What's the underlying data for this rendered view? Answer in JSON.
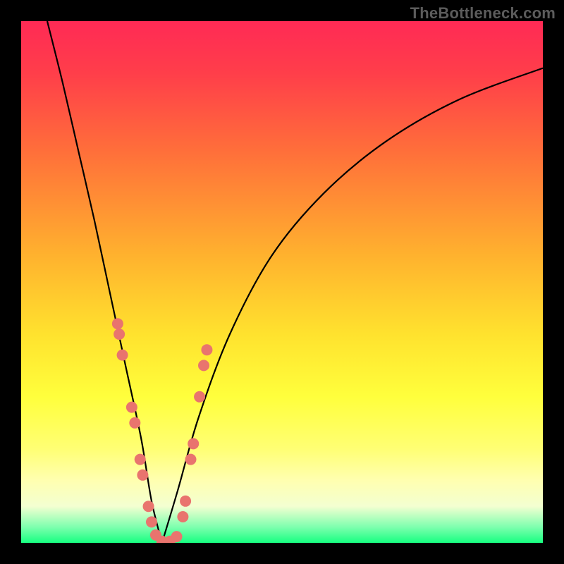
{
  "watermark": "TheBottleneck.com",
  "colors": {
    "frame": "#000000",
    "gradient_stops": [
      {
        "offset": 0.0,
        "color": "#ff2a55"
      },
      {
        "offset": 0.1,
        "color": "#ff3e4a"
      },
      {
        "offset": 0.25,
        "color": "#ff6f3a"
      },
      {
        "offset": 0.45,
        "color": "#ffb22e"
      },
      {
        "offset": 0.6,
        "color": "#ffe22e"
      },
      {
        "offset": 0.72,
        "color": "#ffff3c"
      },
      {
        "offset": 0.82,
        "color": "#ffff74"
      },
      {
        "offset": 0.88,
        "color": "#ffffb0"
      },
      {
        "offset": 0.93,
        "color": "#f3ffd1"
      },
      {
        "offset": 0.97,
        "color": "#7dffae"
      },
      {
        "offset": 1.0,
        "color": "#17ff81"
      }
    ],
    "curve": "#000000",
    "markers": "#e9746e"
  },
  "chart_data": {
    "type": "line",
    "title": "",
    "xlabel": "",
    "ylabel": "",
    "xlim": [
      0,
      100
    ],
    "ylim": [
      0,
      100
    ],
    "note": "x and y are in percent of plot area width/height; y increases upward. Curve is a V-shaped bottleneck profile with minimum around x≈27, y≈0.",
    "series": [
      {
        "name": "bottleneck-curve-left",
        "x": [
          5,
          8,
          11,
          14,
          17,
          20,
          23,
          25,
          27
        ],
        "y": [
          100,
          88,
          75,
          62,
          48,
          34,
          20,
          8,
          0
        ]
      },
      {
        "name": "bottleneck-curve-right",
        "x": [
          27,
          30,
          34,
          40,
          48,
          58,
          70,
          84,
          100
        ],
        "y": [
          0,
          10,
          24,
          40,
          55,
          67,
          77,
          85,
          91
        ]
      }
    ],
    "markers": {
      "name": "highlighted-points",
      "points_xy": [
        [
          18.5,
          42
        ],
        [
          18.8,
          40
        ],
        [
          19.4,
          36
        ],
        [
          21.2,
          26
        ],
        [
          21.8,
          23
        ],
        [
          22.8,
          16
        ],
        [
          23.3,
          13
        ],
        [
          24.4,
          7
        ],
        [
          25.0,
          4
        ],
        [
          25.8,
          1.5
        ],
        [
          27.0,
          0.3
        ],
        [
          28.5,
          0.3
        ],
        [
          29.8,
          1.2
        ],
        [
          31.0,
          5
        ],
        [
          31.5,
          8
        ],
        [
          32.5,
          16
        ],
        [
          33.0,
          19
        ],
        [
          34.2,
          28
        ],
        [
          35.0,
          34
        ],
        [
          35.6,
          37
        ]
      ],
      "radius_px": 8
    }
  }
}
